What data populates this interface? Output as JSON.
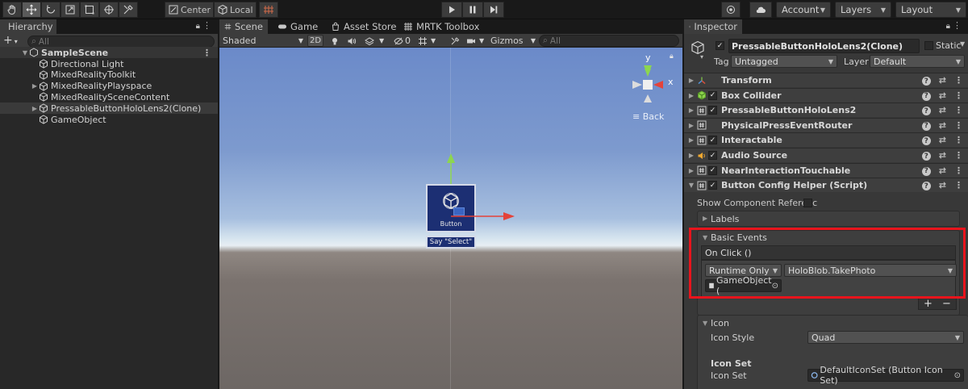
{
  "toolbar": {
    "pivot_label": "Center",
    "space_label": "Local",
    "account_label": "Account",
    "layers_label": "Layers",
    "layout_label": "Layout"
  },
  "hierarchy": {
    "tab_label": "Hierarchy",
    "search_placeholder": "All",
    "scene_name": "SampleScene",
    "items": [
      {
        "label": "Directional Light",
        "expandable": false
      },
      {
        "label": "MixedRealityToolkit",
        "expandable": false
      },
      {
        "label": "MixedRealityPlayspace",
        "expandable": true
      },
      {
        "label": "MixedRealitySceneContent",
        "expandable": false
      },
      {
        "label": "PressableButtonHoloLens2(Clone)",
        "expandable": true,
        "selected": true
      },
      {
        "label": "GameObject",
        "expandable": false
      }
    ]
  },
  "scene": {
    "tabs": [
      "Scene",
      "Game",
      "Asset Store",
      "MRTK Toolbox"
    ],
    "shading_mode": "Shaded",
    "mode_2d_label": "2D",
    "hidden_count": "0",
    "gizmos_label": "Gizmos",
    "search_placeholder": "All",
    "gizmo": {
      "y_label": "y",
      "x_label": "x",
      "back_label": "Back"
    },
    "button_label": "Button",
    "say_label": "Say \"Select\""
  },
  "inspector": {
    "tab_label": "Inspector",
    "object_name": "PressableButtonHoloLens2(Clone)",
    "static_label": "Static",
    "tag_label": "Tag",
    "tag_value": "Untagged",
    "layer_label": "Layer",
    "layer_value": "Default",
    "components": [
      {
        "name": "Transform",
        "has_checkbox": false,
        "checked": false,
        "icon": "transform-icon"
      },
      {
        "name": "Box Collider",
        "has_checkbox": true,
        "checked": true,
        "icon": "box-collider-icon"
      },
      {
        "name": "PressableButtonHoloLens2",
        "has_checkbox": true,
        "checked": true,
        "icon": "script-icon"
      },
      {
        "name": "PhysicalPressEventRouter",
        "has_checkbox": false,
        "checked": false,
        "icon": "script-icon"
      },
      {
        "name": "Interactable",
        "has_checkbox": true,
        "checked": true,
        "icon": "script-icon"
      },
      {
        "name": "Audio Source",
        "has_checkbox": true,
        "checked": true,
        "icon": "audio-source-icon"
      },
      {
        "name": "NearInteractionTouchable",
        "has_checkbox": true,
        "checked": true,
        "icon": "script-icon"
      },
      {
        "name": "Button Config Helper (Script)",
        "has_checkbox": true,
        "checked": true,
        "icon": "script-icon"
      }
    ],
    "show_component_ref_label": "Show Component Referenc",
    "labels_section": "Labels",
    "basic_events_section": "Basic Events",
    "on_click_label": "On Click ()",
    "runtime_value": "Runtime Only",
    "function_value": "HoloBlob.TakePhoto",
    "target_object": "GameObject (",
    "add_label": "+",
    "remove_label": "−",
    "icon_section": "Icon",
    "icon_style_label": "Icon Style",
    "icon_style_value": "Quad",
    "icon_set_heading": "Icon Set",
    "icon_set_label": "Icon Set",
    "icon_set_value": "DefaultIconSet (Button Icon Set)",
    "highlight_color": "#e8141c"
  }
}
